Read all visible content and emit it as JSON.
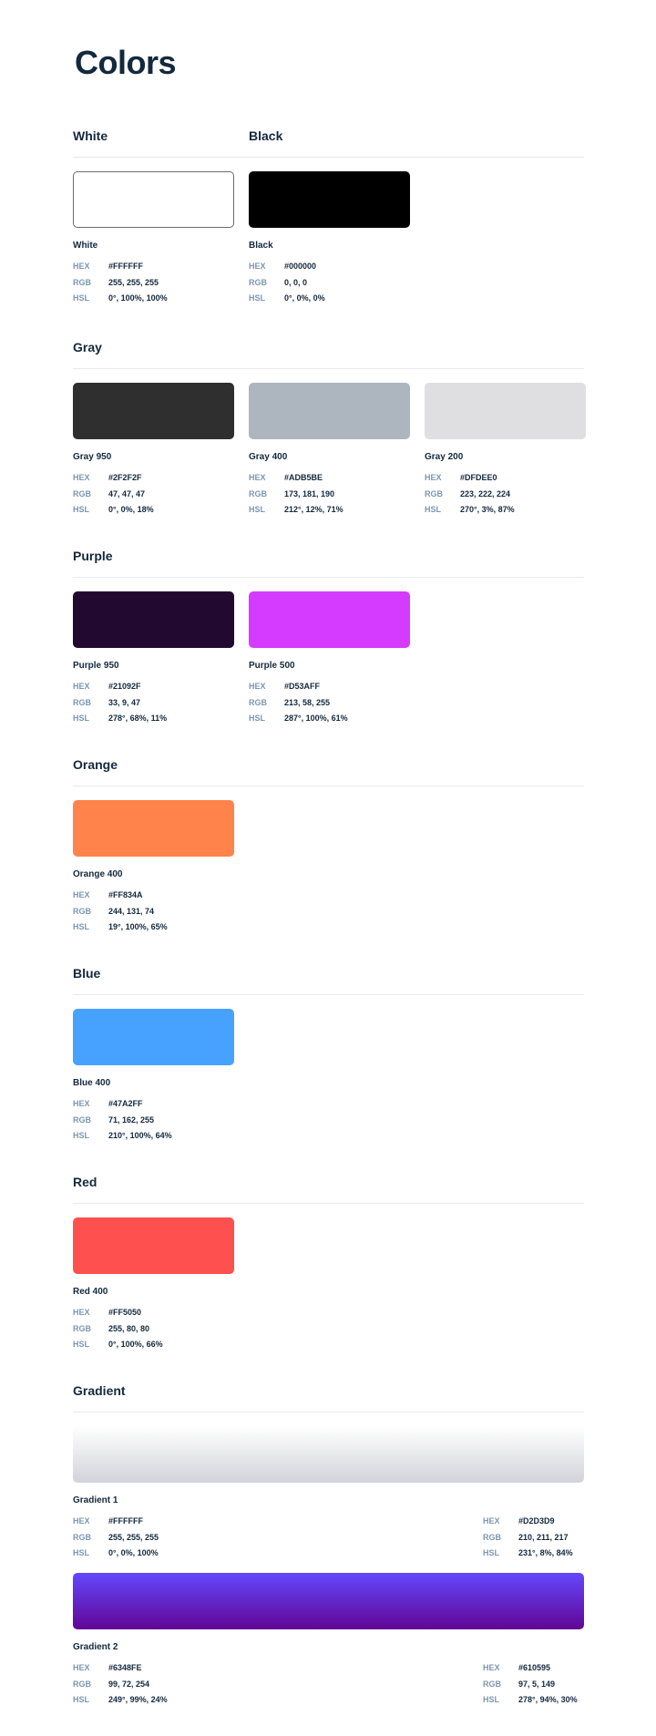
{
  "page": {
    "title": "Colors"
  },
  "labels": {
    "hex": "HEX",
    "rgb": "RGB",
    "hsl": "HSL"
  },
  "sections": {
    "white_black": {
      "white_title": "White",
      "black_title": "Black",
      "colors": [
        {
          "name": "White",
          "hex": "#FFFFFF",
          "rgb": "255, 255, 255",
          "hsl": "0°, 100%, 100%",
          "swatch": "#FFFFFF"
        },
        {
          "name": "Black",
          "hex": "#000000",
          "rgb": "0, 0, 0",
          "hsl": "0°, 0%, 0%",
          "swatch": "#000000"
        }
      ]
    },
    "gray": {
      "title": "Gray",
      "colors": [
        {
          "name": "Gray 950",
          "hex": "#2F2F2F",
          "rgb": "47, 47, 47",
          "hsl": "0°, 0%, 18%",
          "swatch": "#2F2F2F"
        },
        {
          "name": "Gray 400",
          "hex": "#ADB5BE",
          "rgb": "173, 181, 190",
          "hsl": "212°, 12%, 71%",
          "swatch": "#ADB5BE"
        },
        {
          "name": "Gray 200",
          "hex": "#DFDEE0",
          "rgb": "223, 222, 224",
          "hsl": "270°, 3%, 87%",
          "swatch": "#DFDEE0"
        }
      ]
    },
    "purple": {
      "title": "Purple",
      "colors": [
        {
          "name": "Purple 950",
          "hex": "#21092F",
          "rgb": "33, 9, 47",
          "hsl": "278°, 68%, 11%",
          "swatch": "#21092F"
        },
        {
          "name": "Purple 500",
          "hex": "#D53AFF",
          "rgb": "213, 58, 255",
          "hsl": "287°, 100%, 61%",
          "swatch": "#D53AFF"
        }
      ]
    },
    "orange": {
      "title": "Orange",
      "colors": [
        {
          "name": "Orange 400",
          "hex": "#FF834A",
          "rgb": "244, 131, 74",
          "hsl": "19°, 100%, 65%",
          "swatch": "#FF834A"
        }
      ]
    },
    "blue": {
      "title": "Blue",
      "colors": [
        {
          "name": "Blue 400",
          "hex": "#47A2FF",
          "rgb": "71, 162, 255",
          "hsl": "210°, 100%, 64%",
          "swatch": "#47A2FF"
        }
      ]
    },
    "red": {
      "title": "Red",
      "colors": [
        {
          "name": "Red 400",
          "hex": "#FF5050",
          "rgb": "255, 80, 80",
          "hsl": "0°, 100%, 66%",
          "swatch": "#FF5050"
        }
      ]
    },
    "gradient": {
      "title": "Gradient",
      "items": [
        {
          "name": "Gradient 1",
          "start": {
            "hex": "#FFFFFF",
            "rgb": "255, 255, 255",
            "hsl": "0°, 0%, 100%"
          },
          "end": {
            "hex": "#D2D3D9",
            "rgb": "210, 211, 217",
            "hsl": "231°, 8%, 84%"
          }
        },
        {
          "name": "Gradient 2",
          "start": {
            "hex": "#6348FE",
            "rgb": "99, 72, 254",
            "hsl": "249°, 99%, 24%"
          },
          "end": {
            "hex": "#610595",
            "rgb": "97, 5, 149",
            "hsl": "278°, 94%, 30%"
          }
        }
      ]
    }
  }
}
